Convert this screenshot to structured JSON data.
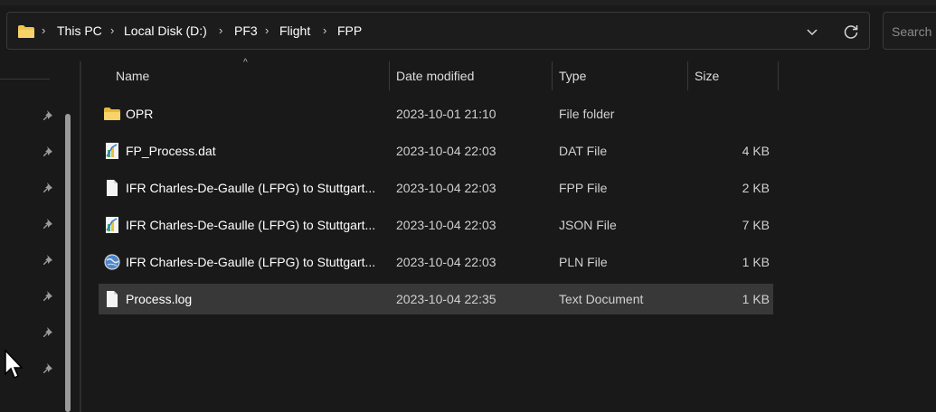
{
  "address_bar": {
    "crumbs": [
      "This PC",
      "Local Disk (D:)",
      "PF3",
      "Flight",
      "FPP"
    ]
  },
  "search": {
    "placeholder": "Search"
  },
  "columns": {
    "name": "Name",
    "date": "Date modified",
    "type": "Type",
    "size": "Size"
  },
  "files": [
    {
      "name": "OPR",
      "date": "2023-10-01 21:10",
      "type": "File folder",
      "size": "",
      "icon": "folder-icon"
    },
    {
      "name": "FP_Process.dat",
      "date": "2023-10-04 22:03",
      "type": "DAT File",
      "size": "4 KB",
      "icon": "data-file-icon"
    },
    {
      "name": "IFR Charles-De-Gaulle (LFPG) to Stuttgart...",
      "date": "2023-10-04 22:03",
      "type": "FPP File",
      "size": "2 KB",
      "icon": "blank-file-icon"
    },
    {
      "name": "IFR Charles-De-Gaulle (LFPG) to Stuttgart...",
      "date": "2023-10-04 22:03",
      "type": "JSON File",
      "size": "7 KB",
      "icon": "data-file-icon"
    },
    {
      "name": "IFR Charles-De-Gaulle (LFPG) to Stuttgart...",
      "date": "2023-10-04 22:03",
      "type": "PLN File",
      "size": "1 KB",
      "icon": "globe-file-icon"
    },
    {
      "name": "Process.log",
      "date": "2023-10-04 22:35",
      "type": "Text Document",
      "size": "1 KB",
      "icon": "text-file-icon"
    }
  ],
  "selected_row": 5,
  "colors": {
    "background": "#191919",
    "selected_row": "#383838",
    "folder": "#f0c54a"
  }
}
